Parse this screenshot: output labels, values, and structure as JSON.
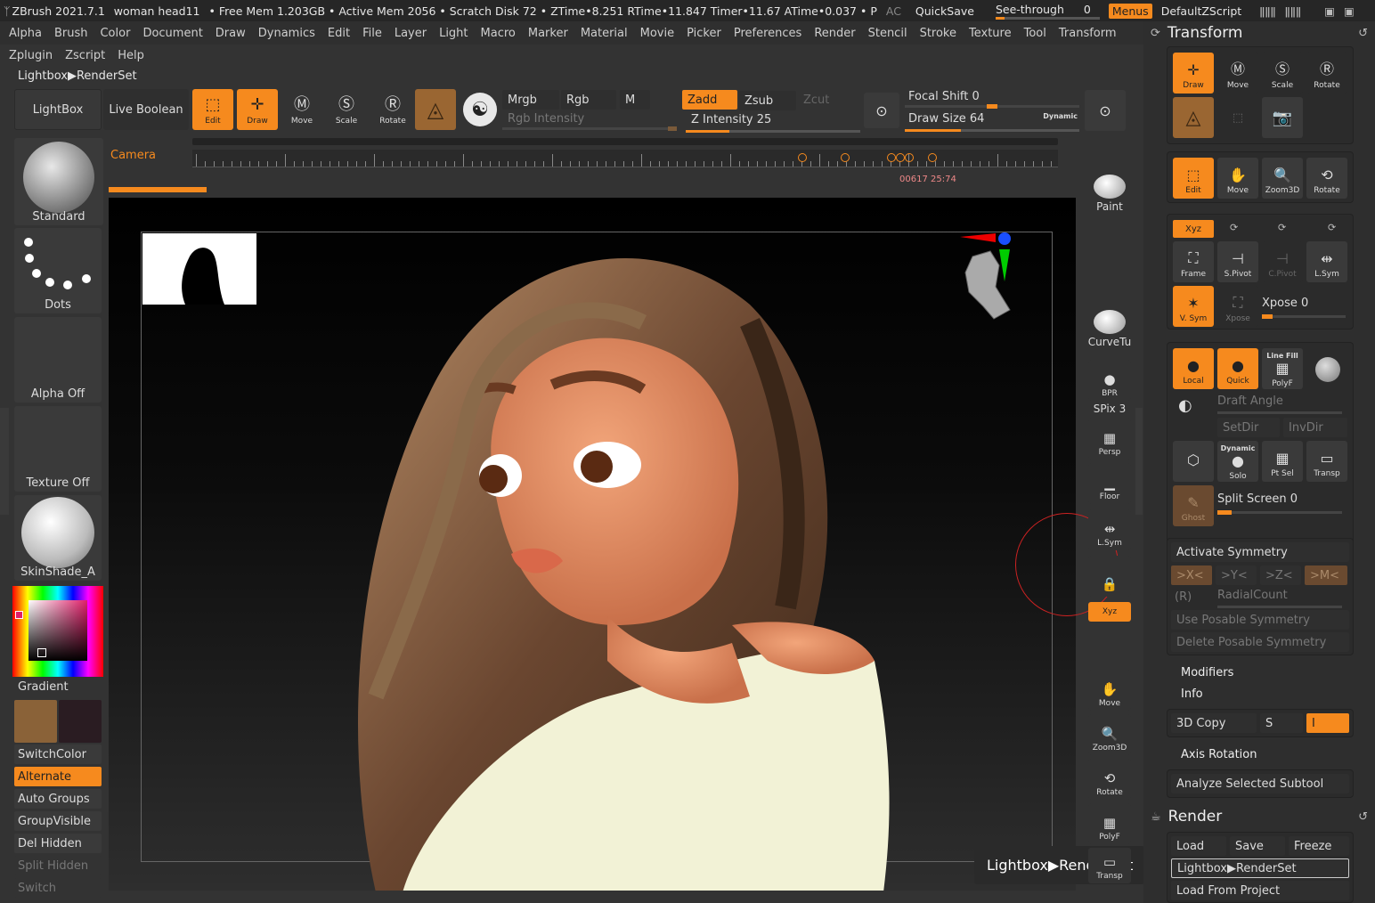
{
  "titlebar": {
    "app": "ZBrush 2021.7.1",
    "doc": "woman head11",
    "mem": "• Free Mem 1.203GB • Active Mem 2056 • Scratch Disk 72 • ZTime•8.251 RTime•11.847 Timer•11.67 ATime•0.037 • P",
    "ac": "AC",
    "quicksave": "QuickSave",
    "seethrough": "See-through",
    "seethrough_value": "0",
    "menus": "Menus",
    "script": "DefaultZScript"
  },
  "menu": [
    "Alpha",
    "Brush",
    "Color",
    "Document",
    "Draw",
    "Dynamics",
    "Edit",
    "File",
    "Layer",
    "Light",
    "Macro",
    "Marker",
    "Material",
    "Movie",
    "Picker",
    "Preferences",
    "Render",
    "Stencil",
    "Stroke",
    "Texture",
    "Tool",
    "Transform"
  ],
  "menu2": [
    "Zplugin",
    "Zscript",
    "Help"
  ],
  "breadcrumb": "Lightbox▶RenderSet",
  "toolbar": {
    "lightbox": "LightBox",
    "live_boolean": "Live Boolean",
    "edit": "Edit",
    "draw": "Draw",
    "move": "Move",
    "scale": "Scale",
    "rotate": "Rotate",
    "mrgb": "Mrgb",
    "rgb": "Rgb",
    "m": "M",
    "rgb_intensity": "Rgb Intensity",
    "zadd": "Zadd",
    "zsub": "Zsub",
    "zcut": "Zcut",
    "z_intensity": "Z Intensity 25",
    "z_intensity_value": 25,
    "focal_shift": "Focal Shift 0",
    "draw_size": "Draw Size 64",
    "draw_size_value": 64,
    "dynamic": "Dynamic",
    "camera": "Camera",
    "timeline_readout": "00617  25:74"
  },
  "left": {
    "brush": "Standard",
    "stroke": "Dots",
    "alpha": "Alpha Off",
    "texture": "Texture Off",
    "material": "SkinShade_A",
    "gradient": "Gradient",
    "main_color": "#8a6238",
    "secondary_color": "#2a1c22",
    "buttons": [
      "SwitchColor",
      "Alternate",
      "Auto Groups",
      "GroupVisible",
      "Del Hidden",
      "Split Hidden",
      "Switch"
    ]
  },
  "shelf": {
    "paint": "Paint",
    "curvetu": "CurveTu",
    "bpr": "BPR",
    "spix": "SPix 3",
    "dynamic": "Dynamic",
    "persp": "Persp",
    "floor": "Floor",
    "lsym": "L.Sym",
    "xyz": "Xyz",
    "move": "Move",
    "zoom3d": "Zoom3D",
    "rotate": "Rotate",
    "linefill": "Line Fill",
    "polyf": "PolyF",
    "transp": "Transp"
  },
  "canvas_note": "Lightbox▶RenderSet",
  "transform": {
    "title": "Transform",
    "draw": "Draw",
    "move": "Move",
    "scale": "Scale",
    "rotate": "Rotate",
    "edit": "Edit",
    "move2": "Move",
    "zoom3d": "Zoom3D",
    "rotate2": "Rotate",
    "xyz": "Xyz",
    "frame": "Frame",
    "spivot": "S.Pivot",
    "cpivot": "C.Pivot",
    "lsym": "L.Sym",
    "vsym": "V. Sym",
    "xpose_btn": "Xpose",
    "xpose": "Xpose 0",
    "local": "Local",
    "quick": "Quick",
    "linefill": "Line Fill",
    "polyf": "PolyF",
    "draft_angle": "Draft Angle",
    "setdir": "SetDir",
    "invdir": "InvDir",
    "dynamic": "Dynamic",
    "solo": "Solo",
    "ptsel": "Pt Sel",
    "transp": "Transp",
    "ghost": "Ghost",
    "split_screen": "Split Screen 0",
    "activate_symmetry": "Activate Symmetry",
    "x": ">X<",
    "y": ">Y<",
    "z": ">Z<",
    "m": ">M<",
    "r": "(R)",
    "radial": "RadialCount",
    "use_posable": "Use Posable Symmetry",
    "delete_posable": "Delete Posable Symmetry",
    "modifiers": "Modifiers",
    "info": "Info",
    "copy3d": "3D Copy",
    "s": "S",
    "i": "I",
    "axis_rotation": "Axis Rotation",
    "analyze": "Analyze Selected Subtool"
  },
  "render": {
    "title": "Render",
    "load": "Load",
    "save": "Save",
    "freeze": "Freeze",
    "renderset": "Lightbox▶RenderSet",
    "load_from_project": "Load From Project"
  }
}
